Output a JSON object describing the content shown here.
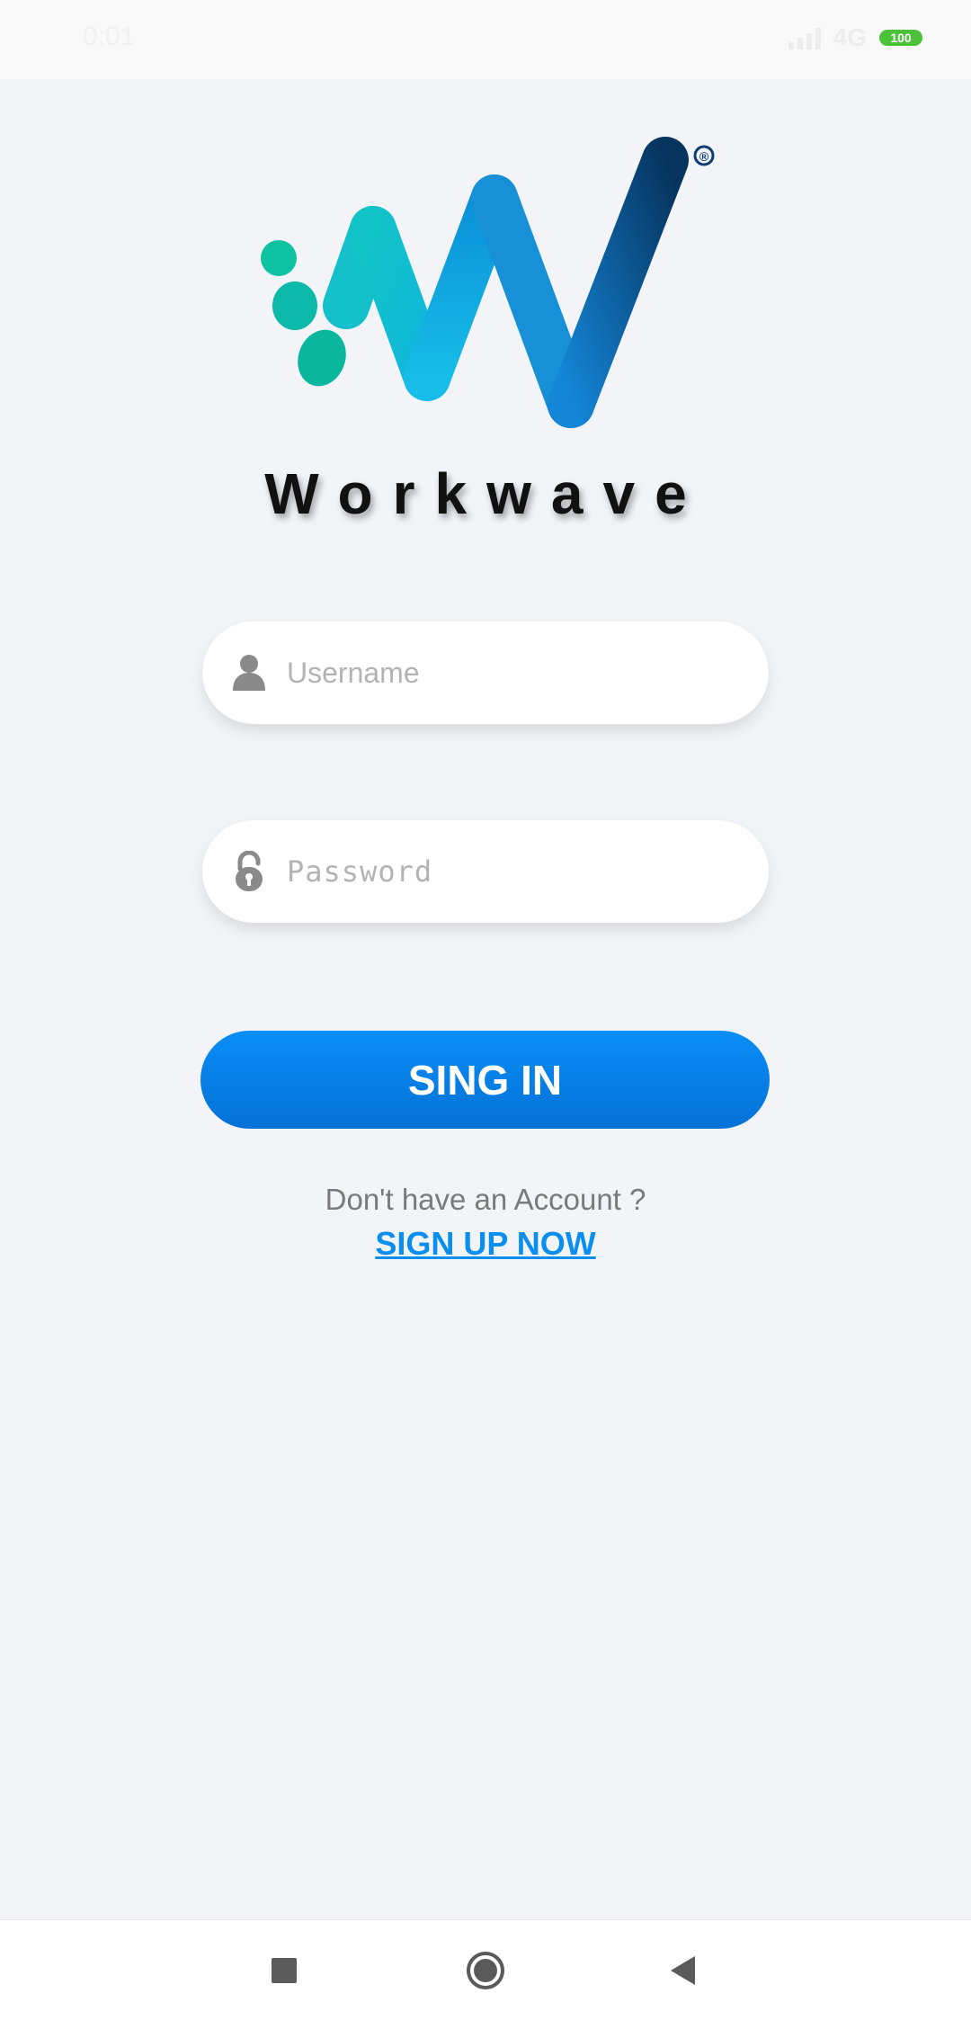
{
  "status_bar": {
    "time": "0:01",
    "network": "4G",
    "battery": "100"
  },
  "app": {
    "brand_name": "Workwave",
    "logo_icon": "workwave-w-logo-icon",
    "registered_mark": "®"
  },
  "login_form": {
    "username_placeholder": "Username",
    "username_value": "",
    "username_icon": "user-icon",
    "password_placeholder": "Password",
    "password_value": "",
    "password_icon": "lock-icon",
    "signin_label": "SING IN"
  },
  "signup": {
    "prompt": "Don't have an Account ?",
    "link_label": "SIGN UP NOW"
  },
  "nav_bar": {
    "recents_icon": "square-icon",
    "home_icon": "circle-home-icon",
    "back_icon": "triangle-back-icon"
  },
  "colors": {
    "background": "#f3f4f8",
    "primary": "#0a8ef0",
    "logo_teal": "#0cc3a0",
    "logo_cyan": "#18c2e6",
    "logo_navy": "#0b3c72"
  }
}
